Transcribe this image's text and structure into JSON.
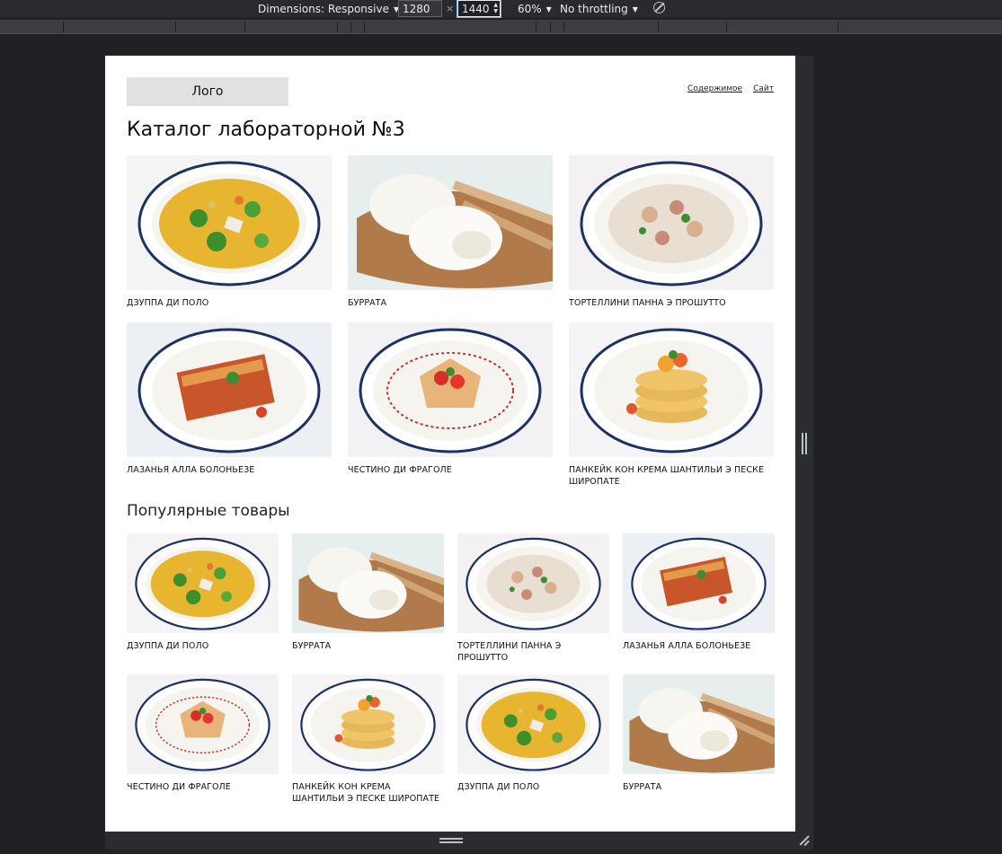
{
  "devtools": {
    "dimensions_label": "Dimensions: Responsive",
    "width": "1280",
    "height": "1440",
    "times": "×",
    "zoom": "60%",
    "throttling": "No throttling"
  },
  "page": {
    "logo": "Лого",
    "nav": [
      "Содержимое",
      "Сайт"
    ],
    "catalog_title": "Каталог лабораторной №3",
    "popular_title": "Популярные товары",
    "catalog_items": [
      {
        "name": "Дзуппа ди поло",
        "dish": "soup"
      },
      {
        "name": "Буррата",
        "dish": "burrata"
      },
      {
        "name": "Тортеллини панна э прошутто",
        "dish": "tortellini"
      },
      {
        "name": "Лазанья алла болоньезе",
        "dish": "lasagna"
      },
      {
        "name": "Честино ди фраголе",
        "dish": "strawberry"
      },
      {
        "name": "Панкейк кон крема шантильи э песке широпате",
        "dish": "pancake"
      }
    ],
    "popular_items": [
      {
        "name": "Дзуппа ди поло",
        "dish": "soup"
      },
      {
        "name": "Буррата",
        "dish": "burrata"
      },
      {
        "name": "Тортеллини панна э прошутто",
        "dish": "tortellini"
      },
      {
        "name": "Лазанья алла болоньезе",
        "dish": "lasagna"
      },
      {
        "name": "Честино ди фраголе",
        "dish": "strawberry"
      },
      {
        "name": "Панкейк кон крема шантильи э песке широпате",
        "dish": "pancake"
      },
      {
        "name": "Дзуппа ди поло",
        "dish": "soup"
      },
      {
        "name": "Буррата",
        "dish": "burrata"
      }
    ]
  }
}
